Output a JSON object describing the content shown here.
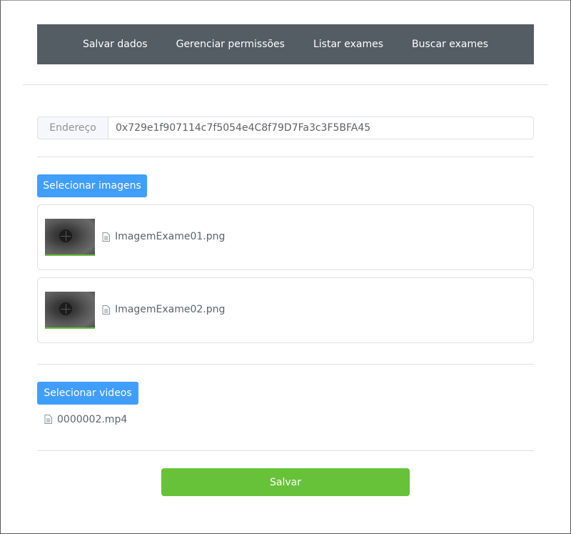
{
  "nav": {
    "items": [
      {
        "label": "Salvar dados"
      },
      {
        "label": "Gerenciar permissões"
      },
      {
        "label": "Listar exames"
      },
      {
        "label": "Buscar exames"
      }
    ]
  },
  "address": {
    "label": "Endereço",
    "value": "0x729e1f907114c7f5054e4C8f79D7Fa3c3F5BFA45"
  },
  "images": {
    "button_label": "Selecionar imagens",
    "files": [
      {
        "name": "ImagemExame01.png",
        "icon": "document-icon",
        "upload_progress": 1.0
      },
      {
        "name": "ImagemExame02.png",
        "icon": "document-icon",
        "upload_progress": 1.0
      }
    ]
  },
  "videos": {
    "button_label": "Selecionar videos",
    "files": [
      {
        "name": "0000002.mp4",
        "icon": "document-icon"
      }
    ]
  },
  "save_button": {
    "label": "Salvar"
  },
  "colors": {
    "navbar": "#545c64",
    "primary": "#409eff",
    "success": "#67c23a",
    "border": "#dcdfe6"
  }
}
